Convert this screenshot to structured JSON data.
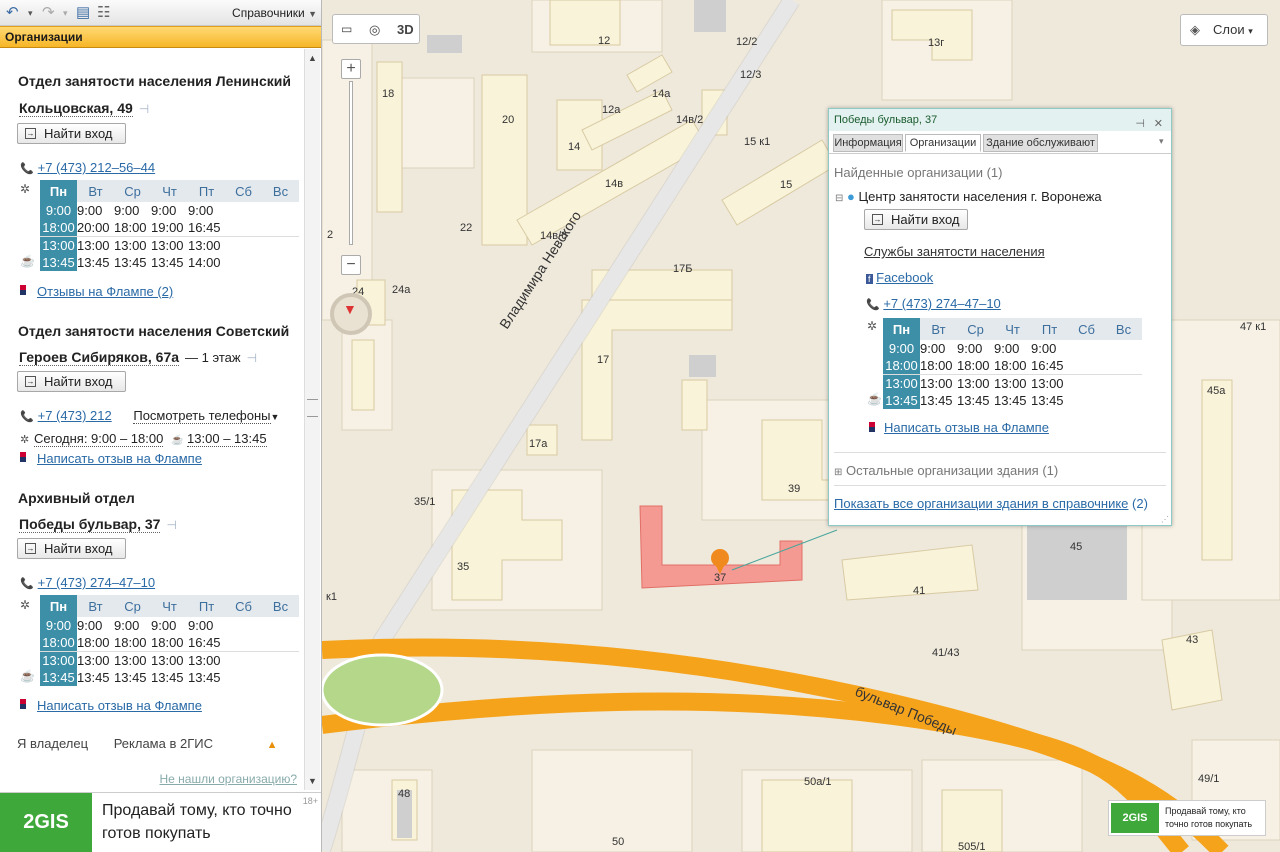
{
  "toolbar": {
    "directories_label": "Справочники"
  },
  "orgbar": {
    "title": "Организации"
  },
  "days": [
    "Пн",
    "Вт",
    "Ср",
    "Чт",
    "Пт",
    "Сб",
    "Вс"
  ],
  "orgs": [
    {
      "name": "Отдел занятости населения Ленинский",
      "address": "Кольцовская, 49",
      "find_entrance": "Найти вход",
      "phone": "+7 (473) 212–56–44",
      "work_open": [
        "9:00",
        "9:00",
        "9:00",
        "9:00",
        "9:00"
      ],
      "work_close": [
        "18:00",
        "20:00",
        "18:00",
        "19:00",
        "16:45"
      ],
      "break_start": [
        "13:00",
        "13:00",
        "13:00",
        "13:00",
        "13:00"
      ],
      "break_end": [
        "13:45",
        "13:45",
        "13:45",
        "13:45",
        "14:00"
      ],
      "review_link": "Отзывы на Флампе (2)"
    },
    {
      "name": "Отдел занятости населения Советский",
      "address": "Героев Сибиряков, 67а",
      "floor": "— 1 этаж",
      "find_entrance": "Найти вход",
      "phone": "+7 (473) 212",
      "view_phones": "Посмотреть телефоны",
      "today_label": "Сегодня: 9:00 – 18:00",
      "today_break": "13:00 – 13:45",
      "review_link": "Написать отзыв на Флампе"
    },
    {
      "name": "Архивный отдел",
      "address": "Победы бульвар, 37",
      "find_entrance": "Найти вход",
      "phone": "+7 (473) 274–47–10",
      "work_open": [
        "9:00",
        "9:00",
        "9:00",
        "9:00",
        "9:00"
      ],
      "work_close": [
        "18:00",
        "18:00",
        "18:00",
        "18:00",
        "16:45"
      ],
      "break_start": [
        "13:00",
        "13:00",
        "13:00",
        "13:00",
        "13:00"
      ],
      "break_end": [
        "13:45",
        "13:45",
        "13:45",
        "13:45",
        "13:45"
      ],
      "review_link": "Написать отзыв на Флампе"
    }
  ],
  "footer": {
    "owner": "Я владелец",
    "ads": "Реклама в 2ГИС",
    "not_found": "Не нашли организацию?"
  },
  "ad": {
    "brand": "2GIS",
    "text_line1": "Продавай тому, кто точно",
    "text_line2": "готов покупать",
    "age": "18+"
  },
  "map": {
    "tool_3d": "3D",
    "layers": "Слои",
    "streets": {
      "nevsky": "Владимира Невского",
      "pobedy": "бульвар Победы"
    },
    "buildings": [
      "12",
      "12/2",
      "12/3",
      "13г",
      "14а",
      "14в/2",
      "12а",
      "14",
      "15 к1",
      "15",
      "14в",
      "14в/6",
      "22",
      "17Б",
      "20",
      "18",
      "24а",
      "24",
      "17",
      "17а",
      "35/1",
      "39",
      "35",
      "37",
      "41",
      "45",
      "41/43",
      "43",
      "45а",
      "47 к1",
      "48",
      "50",
      "50а/1",
      "49/1",
      "505/1",
      "к1",
      "2"
    ],
    "ad_line1": "Продавай тому, кто",
    "ad_line2": "точно готов покупать"
  },
  "popup": {
    "title": "Победы бульвар, 37",
    "tabs": [
      "Информация",
      "Организации",
      "Здание обслуживают"
    ],
    "found": "Найденные организации (1)",
    "org_name": "Центр занятости населения г. Воронежа",
    "find_entrance": "Найти вход",
    "category": "Службы занятости населения",
    "facebook": "Facebook",
    "phone": "+7 (473) 274–47–10",
    "work_open": [
      "9:00",
      "9:00",
      "9:00",
      "9:00",
      "9:00"
    ],
    "work_close": [
      "18:00",
      "18:00",
      "18:00",
      "18:00",
      "16:45"
    ],
    "break_start": [
      "13:00",
      "13:00",
      "13:00",
      "13:00",
      "13:00"
    ],
    "break_end": [
      "13:45",
      "13:45",
      "13:45",
      "13:45",
      "13:45"
    ],
    "review_link": "Написать отзыв на Флампе",
    "other_orgs": "Остальные организации здания (1)",
    "show_all": "Показать все организации здания в справочнике",
    "show_all_count": "(2)"
  }
}
